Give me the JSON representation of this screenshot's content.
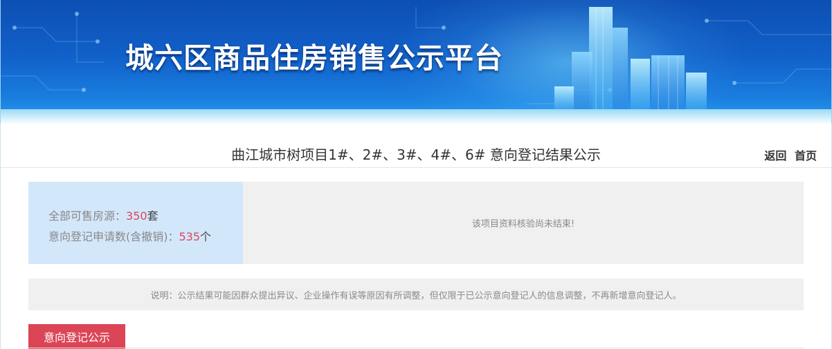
{
  "header": {
    "site_title": "城六区商品住房销售公示平台"
  },
  "page": {
    "title": "曲江城市树项目1#、2#、3#、4#、6# 意向登记结果公示",
    "nav": {
      "back": "返回",
      "home": "首页"
    }
  },
  "stats": {
    "available_label": "全部可售房源：",
    "available_value": "350",
    "available_unit": "套",
    "applications_label": "意向登记申请数(含撤销)：",
    "applications_value": "535",
    "applications_unit": "个"
  },
  "notice": "该项目资料核验尚未结束!",
  "note": "说明：公示结果可能因群众提出异议、企业操作有误等原因有所调整，但仅限于已公示意向登记人的信息调整，不再新增意向登记人。",
  "tabs": [
    "意向登记公示"
  ],
  "colors": {
    "accent": "#dc4556",
    "stats_bg": "#d3e7fb",
    "banner": "#1160c9"
  }
}
